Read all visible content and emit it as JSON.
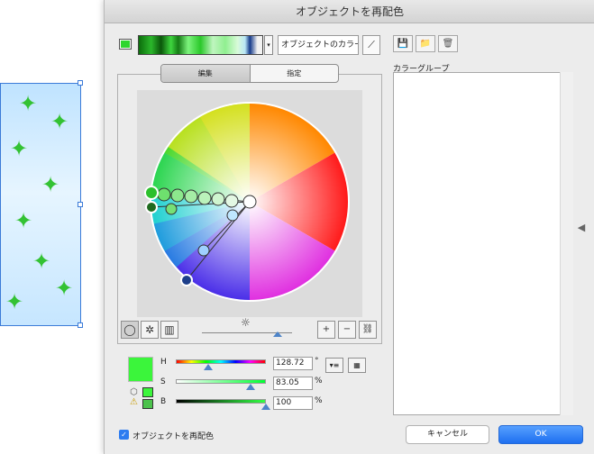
{
  "dialog": {
    "title": "オブジェクトを再配色"
  },
  "top": {
    "preset_name": "オブジェクトのカラー",
    "dropdown_glyph": "▾",
    "eyedrop_glyph": "⟋",
    "icons": {
      "save": "💾",
      "new_group": "📁",
      "delete": "🗑"
    }
  },
  "tabs": {
    "edit": "編集",
    "assign": "指定"
  },
  "groups": {
    "label": "カラーグループ",
    "toggle_glyph": "◀"
  },
  "wheel": {
    "bright_glyph": "☼",
    "mode_glyphs": {
      "smooth": "◯",
      "segmented": "✲",
      "bars": "▥"
    },
    "tool_glyphs": {
      "add": "+",
      "remove": "−",
      "link": "⛓"
    }
  },
  "sliders": {
    "h": {
      "label": "H",
      "value": "128.72",
      "unit": "°",
      "fraction": 0.36
    },
    "s": {
      "label": "S",
      "value": "83.05",
      "unit": "%",
      "fraction": 0.83
    },
    "b": {
      "label": "B",
      "value": "100",
      "unit": "%",
      "fraction": 1.0
    }
  },
  "side_buttons": {
    "menu_glyph": "▾≡",
    "table_glyph": "▦"
  },
  "gamut": {
    "cube_glyph": "⬡",
    "warn_glyph": "⚠"
  },
  "footer": {
    "recolor_checkbox_glyph": "✓",
    "recolor_label": "オブジェクトを再配色",
    "cancel": "キャンセル",
    "ok": "OK"
  },
  "colors": {
    "current": "#3bf53b",
    "accent": "#2d7cf0"
  }
}
